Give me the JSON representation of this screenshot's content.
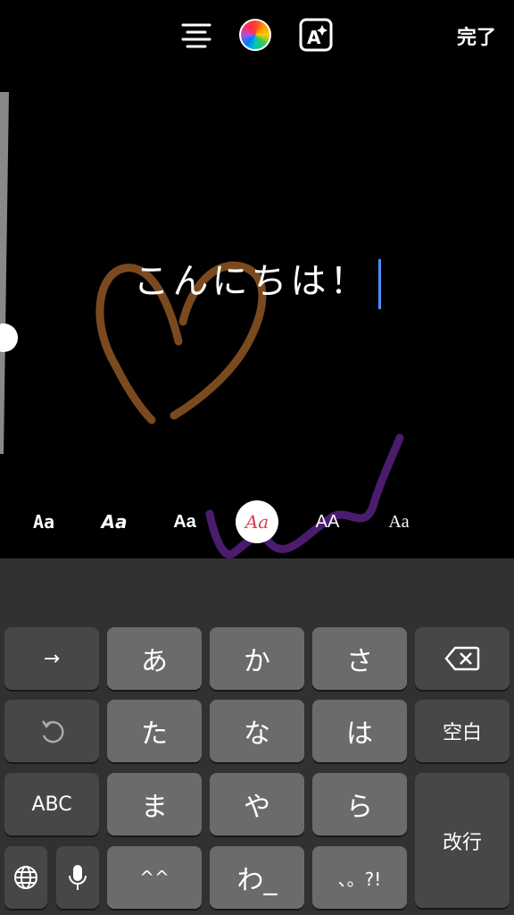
{
  "toolbar": {
    "align_icon": "align-center-icon",
    "color_icon": "color-wheel-icon",
    "effect_icon": "text-effect-icon",
    "effect_label": "A",
    "done_label": "完了"
  },
  "editor": {
    "text": "こんにちは！"
  },
  "font_styles": [
    {
      "label": "Aa"
    },
    {
      "label": "Aa"
    },
    {
      "label": "Aa"
    },
    {
      "label": "Aa",
      "selected": true
    },
    {
      "label": "AA"
    },
    {
      "label": "Aa"
    }
  ],
  "keyboard": {
    "row1": [
      "→",
      "あ",
      "か",
      "さ"
    ],
    "backspace_icon": "backspace-icon",
    "row2": [
      "undo-icon",
      "た",
      "な",
      "は",
      "空白"
    ],
    "row3": [
      "ABC",
      "ま",
      "や",
      "ら",
      "改行"
    ],
    "row4": [
      "globe-icon",
      "mic-icon",
      "^^",
      "わ_",
      "、。?!"
    ]
  },
  "colors": {
    "stroke_brown": "#7a4a1e",
    "stroke_purple": "#4b1c6e",
    "caret": "#4a90ff"
  }
}
